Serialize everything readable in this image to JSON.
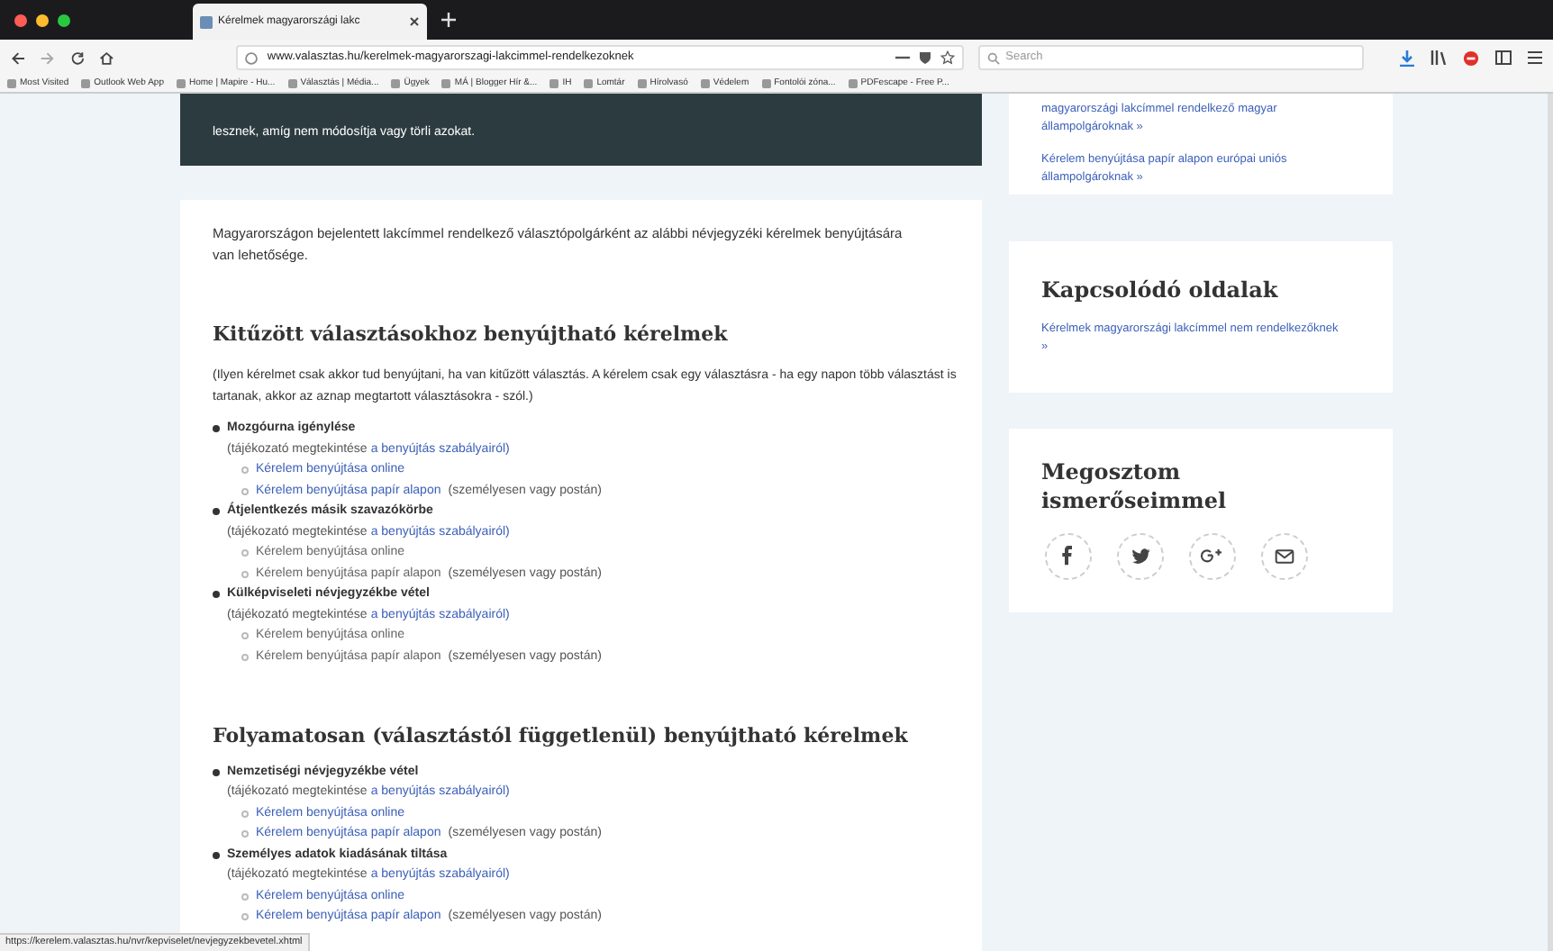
{
  "browser": {
    "tab_title": "Kérelmek magyarországi lakc",
    "url": "www.valasztas.hu/kerelmek-magyarorszagi-lakcimmel-rendelkezoknek",
    "search_placeholder": "Search",
    "bookmarks": [
      "Most Visited",
      "Outlook Web App",
      "Home | Mapire - Hu...",
      "Választás | Média...",
      "Ügyek",
      "MÁ | Blogger Hír &...",
      "IH",
      "Lomtár",
      "Hírolvasó",
      "Védelem",
      "Fontolói zóna...",
      "PDFescape - Free P..."
    ]
  },
  "banner": "lesznek, amíg nem módosítja vagy törli azokat.",
  "intro": "Magyarországon bejelentett lakcímmel rendelkező választópolgárként az alábbi névjegyzéki kérelmek benyújtására van lehetősége.",
  "sections": [
    {
      "title": "Kitűzött választásokhoz benyújtható kérelmek",
      "note": "(Ilyen kérelmet csak akkor tud benyújtani, ha van kitűzött választás. A kérelem csak egy választásra - ha egy napon több választást is tartanak, akkor az aznap megtartott választásokra - szól.)",
      "items": [
        {
          "title": "Mozgóurna igénylése",
          "info": "(tájékozató megtekintése",
          "info_link": "a benyújtás szabályairól)",
          "options": [
            {
              "text": "Kérelem benyújtása online",
              "linked": true
            },
            {
              "text": "Kérelem benyújtása papír alapon",
              "linked": true,
              "suffix": "(személyesen vagy postán)"
            }
          ]
        },
        {
          "title": "Átjelentkezés másik szavazókörbe",
          "info": "(tájékozató megtekintése",
          "info_link": "a benyújtás szabályairól)",
          "options": [
            {
              "text": "Kérelem benyújtása online",
              "linked": false
            },
            {
              "text": "Kérelem benyújtása papír alapon",
              "linked": false,
              "suffix": "(személyesen vagy postán)"
            }
          ]
        },
        {
          "title": "Külképviseleti névjegyzékbe vétel",
          "info": "(tájékozató megtekintése",
          "info_link": "a benyújtás szabályairól)",
          "options": [
            {
              "text": "Kérelem benyújtása online",
              "linked": false
            },
            {
              "text": "Kérelem benyújtása papír alapon",
              "linked": false,
              "suffix": "(személyesen vagy postán)"
            }
          ]
        }
      ]
    },
    {
      "title": "Folyamatosan (választástól függetlenül) benyújtható kérelmek",
      "items": [
        {
          "title": "Nemzetiségi névjegyzékbe vétel",
          "info": "(tájékozató megtekintése",
          "info_link": "a benyújtás szabályairól)",
          "options": [
            {
              "text": "Kérelem benyújtása online",
              "linked": true
            },
            {
              "text": "Kérelem benyújtása papír alapon",
              "linked": true,
              "suffix": "(személyesen vagy postán)"
            }
          ]
        },
        {
          "title": "Személyes adatok kiadásának tiltása",
          "info": "(tájékozató megtekintése",
          "info_link": "a benyújtás szabályairól)",
          "options": [
            {
              "text": "Kérelem benyújtása online",
              "linked": true
            },
            {
              "text": "Kérelem benyújtása papír alapon",
              "linked": true,
              "suffix": "(személyesen vagy postán)"
            }
          ]
        }
      ]
    }
  ],
  "sidebar": {
    "top_links": [
      "magyarországi lakcímmel rendelkező magyar állampolgároknak »",
      "Kérelem benyújtása papír alapon európai uniós állampolgároknak »"
    ],
    "related": {
      "title": "Kapcsolódó oldalak",
      "links": [
        "Kérelmek magyarországi lakcímmel nem rendelkezőknek »"
      ]
    },
    "share": {
      "title": "Megosztom ismerőseimmel",
      "buttons": [
        {
          "kind": "facebook"
        },
        {
          "kind": "twitter"
        },
        {
          "kind": "googleplus"
        },
        {
          "kind": "email"
        }
      ]
    }
  },
  "status_url": "https://kerelem.valasztas.hu/nvr/kepviselet/nevjegyzekbevetel.xhtml"
}
